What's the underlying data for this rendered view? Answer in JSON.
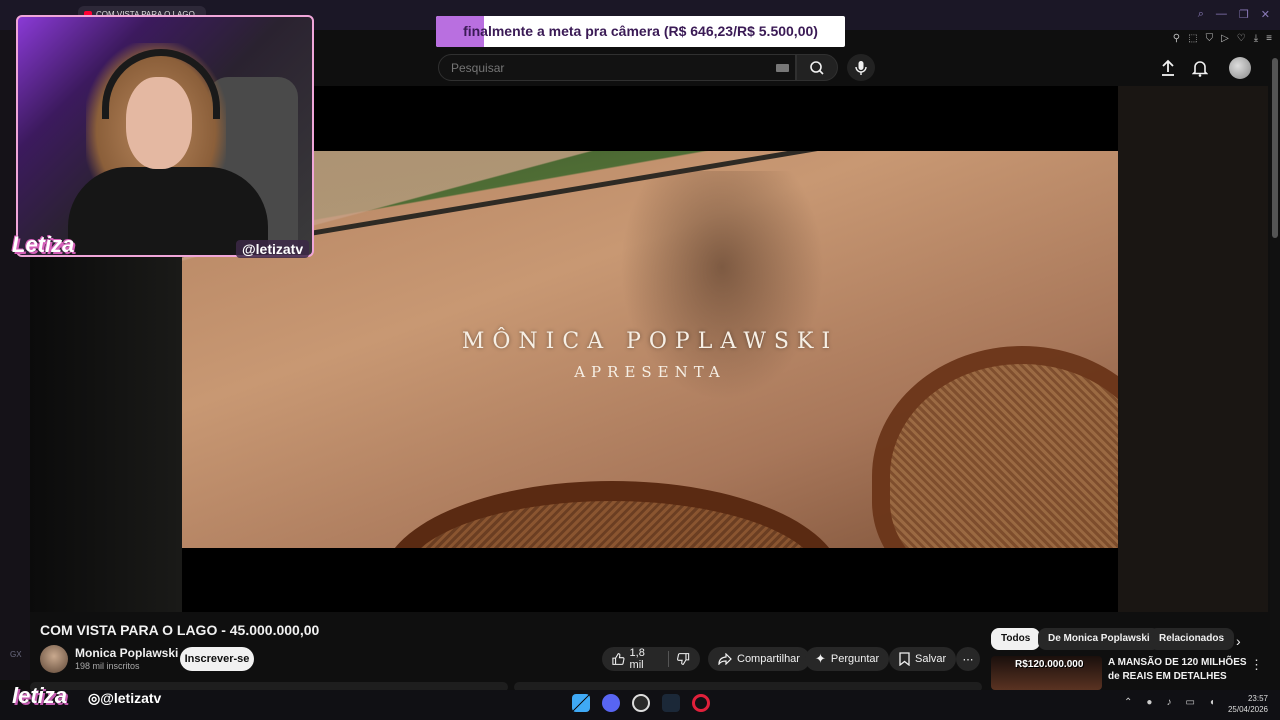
{
  "browser": {
    "tab_title": "COM VISTA PARA O LAGO",
    "gx_label": "GX"
  },
  "goal": {
    "text": "finalmente a meta pra câmera (R$ 646,23/R$ 5.500,00)",
    "progress_fraction": 0.1175,
    "fill_color": "#b96fe0"
  },
  "header": {
    "search_placeholder": "Pesquisar",
    "icons": [
      "search-icon",
      "mic-icon",
      "upload-icon",
      "bell-icon"
    ]
  },
  "video": {
    "overlay_line1": "MÔNICA POPLAWSKI",
    "overlay_line2": "APRESENTA",
    "title": "COM VISTA PARA O LAGO - 45.000.000,00"
  },
  "webcam": {
    "name": "Letiza",
    "handle": "@letizatv"
  },
  "channel": {
    "name": "Monica Poplawski",
    "subscribers": "198 mil inscritos",
    "subscribe_label": "Inscrever-se"
  },
  "actions": {
    "likes": "1,8 mil",
    "share": "Compartilhar",
    "ask": "Perguntar",
    "save": "Salvar"
  },
  "chips": {
    "all": "Todos",
    "from": "De Monica Poplawski",
    "related": "Relacionados"
  },
  "related": {
    "thumb_text": "R$120.000.000",
    "title": "A MANSÃO DE 120 MILHÕES de REAIS EM DETALHES"
  },
  "overlay": {
    "logo": "letiza",
    "instagram": "@letizatv"
  },
  "taskbar": {
    "time": "23:57",
    "date": "25/04/2026"
  }
}
